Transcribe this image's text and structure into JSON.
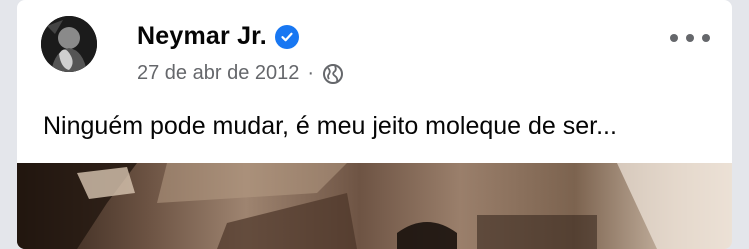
{
  "post": {
    "author": "Neymar Jr.",
    "date": "27 de abr de 2012",
    "separator": "·",
    "text": "Ninguém pode mudar, é meu jeito moleque de ser...",
    "privacy_icon": "globe-icon",
    "more_icon": "more-options-icon",
    "verified_icon": "verified-badge-icon"
  },
  "colors": {
    "verified": "#1877f2",
    "secondary_text": "#65676b",
    "primary_text": "#050505"
  }
}
